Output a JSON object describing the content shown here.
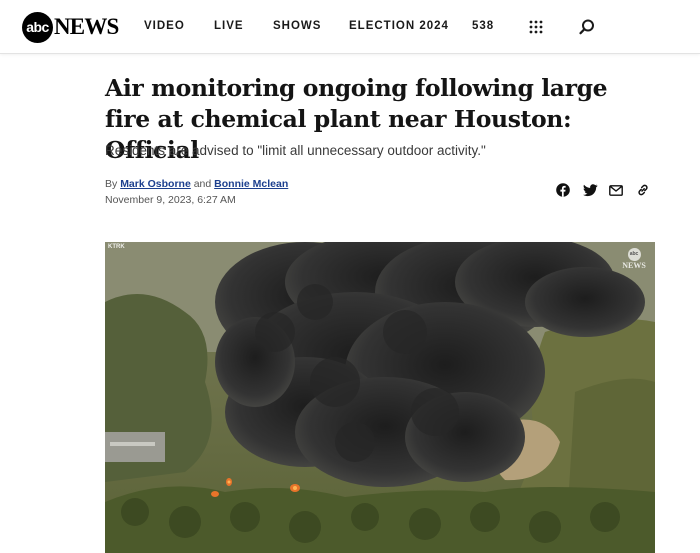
{
  "header": {
    "logo_mark": "abc",
    "logo_news": "NEWS",
    "nav": [
      "VIDEO",
      "LIVE",
      "SHOWS",
      "ELECTION 2024",
      "538"
    ],
    "grid_icon": "grid-dots-icon",
    "search_icon": "search-icon"
  },
  "article": {
    "headline": "Air monitoring ongoing following large fire at chemical plant near Houston: Official",
    "subhead": "Residents are advised to \"limit all unnecessary outdoor activity.\"",
    "byline_prefix": "By",
    "author1": "Mark Osborne",
    "byline_and": "and",
    "author2": "Bonnie Mclean",
    "date": "November 9, 2023, 6:27 AM"
  },
  "share": {
    "icons": [
      "facebook-icon",
      "twitter-icon",
      "email-icon",
      "link-icon"
    ]
  },
  "hero": {
    "watermark": "NEWS",
    "watermark_mark": "abc",
    "station_bug": "KTRK"
  },
  "colors": {
    "author_link": "#1c3f8e",
    "smoke": "#2b2b2b",
    "trees": "#4f5a2e",
    "flames": "#e8742a"
  }
}
